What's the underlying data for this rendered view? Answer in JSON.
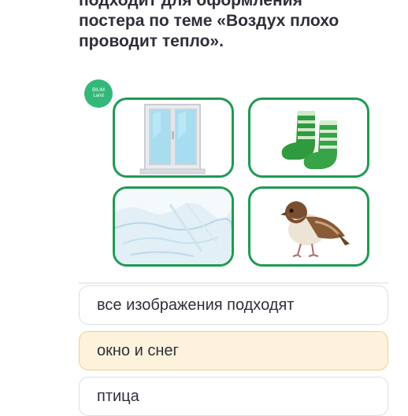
{
  "question": {
    "lines": [
      "подходит для оформления",
      "постера по теме «Воздух плохо",
      "проводит тепло»."
    ]
  },
  "logo": {
    "line1": "BILIM",
    "line2": "Land"
  },
  "images": [
    {
      "icon": "window-icon"
    },
    {
      "icon": "socks-icon"
    },
    {
      "icon": "snow-icon"
    },
    {
      "icon": "sparrow-icon"
    }
  ],
  "options": [
    {
      "label": "все изображения подходят",
      "selected": false
    },
    {
      "label": "окно и снег",
      "selected": true
    },
    {
      "label": "птица",
      "selected": false
    }
  ],
  "colors": {
    "accent_green": "#1f9a53",
    "logo_green": "#34b87a",
    "selected_fill": "#fdf3dc",
    "selected_border": "#f3cf80"
  }
}
